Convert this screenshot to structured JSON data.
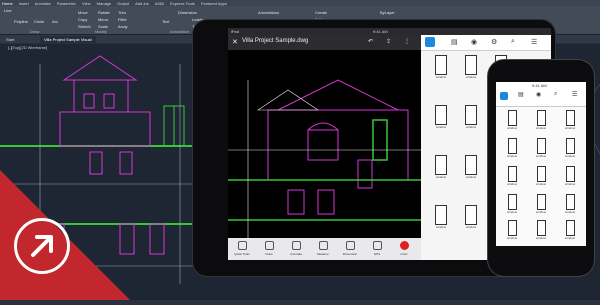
{
  "desktop": {
    "ribbon_tabs": [
      "Home",
      "Insert",
      "Annotate",
      "Parametric",
      "View",
      "Manage",
      "Output",
      "Add-ins",
      "A360",
      "Express Tools",
      "Featured Apps"
    ],
    "draw_tools": [
      "Line",
      "Polyline",
      "Circle",
      "Arc"
    ],
    "modify_tools": [
      "Move",
      "Copy",
      "Stretch",
      "Rotate",
      "Mirror",
      "Scale",
      "Trim",
      "Fillet",
      "Array"
    ],
    "annotation_tools": [
      "Text",
      "Dimension",
      "Leader",
      "Table"
    ],
    "layer_label": "Annotations",
    "make_current": "Make Current",
    "match_layer": "Match Layer",
    "create_label": "Create",
    "edit_label": "Edit",
    "bylayer": "ByLayer",
    "group_labels": {
      "draw": "Draw",
      "modify": "Modify",
      "annotation": "Annotation"
    },
    "doc_tabs": [
      "Start",
      "Villa Project Sample Visual"
    ],
    "viewport_label": "[-][Top][2D Wireframe]"
  },
  "ipad": {
    "status_left": "iPad",
    "status_time": "9:41 AM",
    "file_title": "Villa Project Sample.dwg",
    "tools": [
      "Quick Tools",
      "Draw",
      "Annotate",
      "Measure",
      "Dimension",
      "GPS",
      "Color"
    ],
    "panel_items": [
      "window",
      "window",
      "window",
      "window",
      "window",
      "window",
      "window",
      "window",
      "window",
      "window",
      "window",
      "window"
    ]
  },
  "iphone": {
    "status_time": "9:41 AM",
    "cells": [
      "window",
      "window",
      "window",
      "window",
      "window",
      "window",
      "window",
      "window",
      "window",
      "window",
      "window",
      "window",
      "window",
      "window",
      "window"
    ]
  },
  "colors": {
    "red_brand": "#c1272d",
    "desktop_bg": "#1f2633",
    "cad_magenta": "#d438d4",
    "cad_green": "#37c837",
    "cad_white": "#e8e8e8"
  },
  "icons": [
    "arrow-up-right-icon",
    "share-icon",
    "undo-icon",
    "layers-icon",
    "eye-icon",
    "search-icon",
    "close-icon"
  ]
}
